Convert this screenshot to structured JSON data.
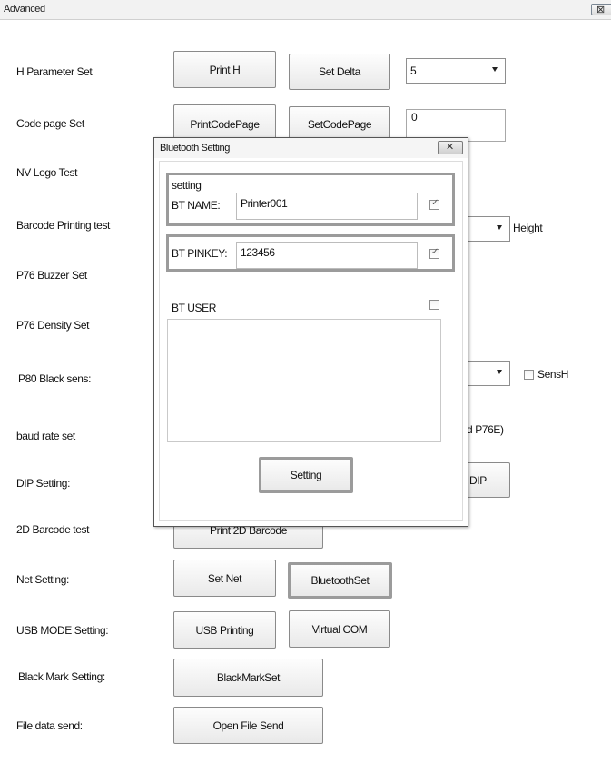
{
  "window": {
    "title": "Advanced",
    "close_glyph": "⊠"
  },
  "rows": {
    "h_param": {
      "label": "H Parameter Set",
      "print_h": "Print H",
      "set_delta": "Set Delta",
      "delta_value": "5"
    },
    "code_page": {
      "label": "Code page Set",
      "print_code_page": "PrintCodePage",
      "set_code_page": "SetCodePage",
      "code_value": "0"
    },
    "nv_logo": {
      "label": "NV Logo Test"
    },
    "barcode": {
      "label": "Barcode Printing test",
      "height_label": "Height"
    },
    "buzzer": {
      "label": "P76 Buzzer Set"
    },
    "density": {
      "label": "P76 Density Set"
    },
    "black_sens": {
      "label": "P80 Black sens:",
      "sensh_label": "SensH"
    },
    "baud": {
      "label": "baud rate set",
      "partial_text": "d P76E)"
    },
    "dip": {
      "label": "DIP Setting:",
      "dip_button": "DIP"
    },
    "barcode2d": {
      "label": "2D Barcode test",
      "print_2d": "Print 2D Barcode"
    },
    "net": {
      "label": "Net Setting:",
      "set_net": "Set Net",
      "bluetooth_set": "BluetoothSet"
    },
    "usb": {
      "label": "USB MODE Setting:",
      "usb_printing": "USB Printing",
      "virtual_com": "Virtual COM"
    },
    "black_mark": {
      "label": "Black Mark Setting:",
      "black_mark_set": "BlackMarkSet"
    },
    "file_send": {
      "label": "File data send:",
      "open_file_send": "Open File Send"
    }
  },
  "dialog": {
    "title": "Bluetooth Setting",
    "close_glyph": "✕",
    "group_label": "setting",
    "bt_name_label": "BT NAME:",
    "bt_name_value": "Printer001",
    "bt_name_checked": true,
    "bt_pinkey_label": "BT PINKEY:",
    "bt_pinkey_value": "123456",
    "bt_pinkey_checked": true,
    "bt_user_label": "BT USER",
    "bt_user_checked": false,
    "check_glyph": "✓",
    "setting_button": "Setting"
  }
}
